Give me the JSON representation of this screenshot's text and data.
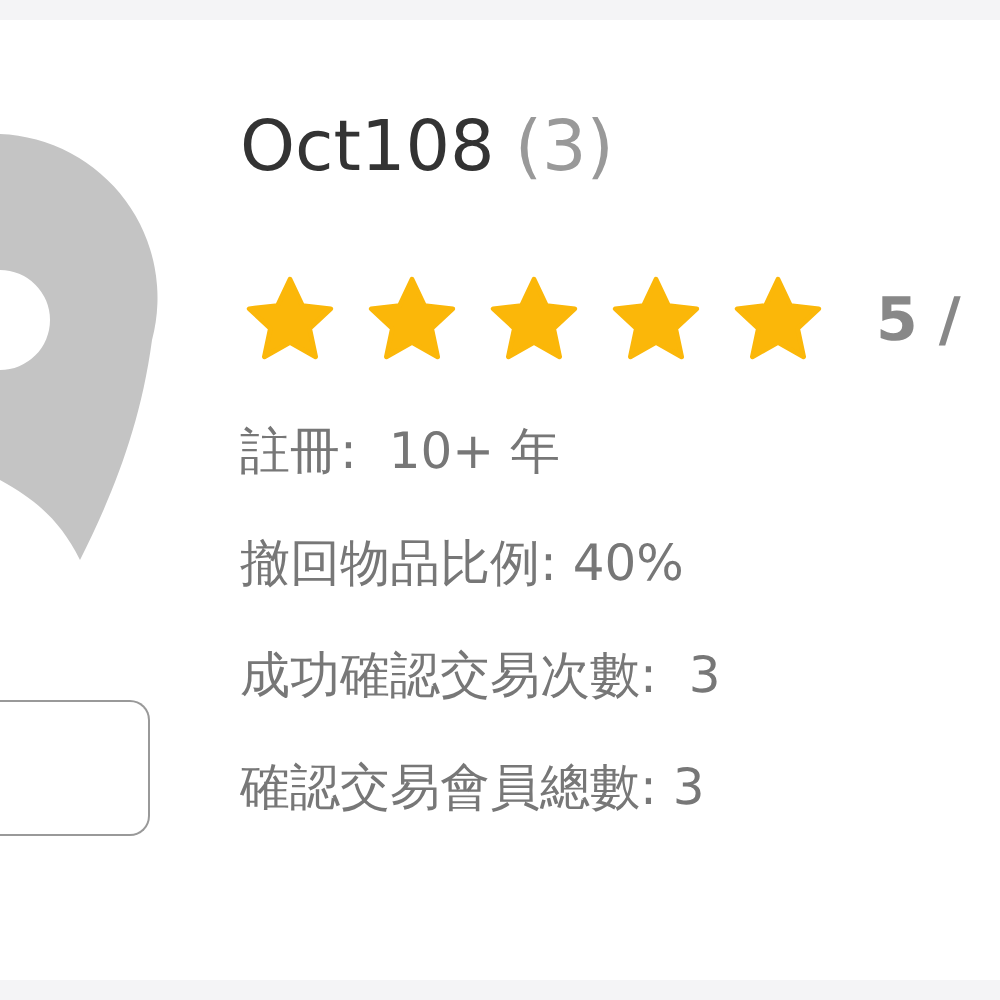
{
  "profile": {
    "username": "Oct108",
    "count": "(3)",
    "stars": 5,
    "rating": "5 /"
  },
  "details": [
    {
      "text": "註冊:  10+ 年"
    },
    {
      "text": "撤回物品比例: 40%"
    },
    {
      "text": "成功確認交易次數:  3"
    },
    {
      "text": "確認交易會員總數: 3"
    }
  ]
}
